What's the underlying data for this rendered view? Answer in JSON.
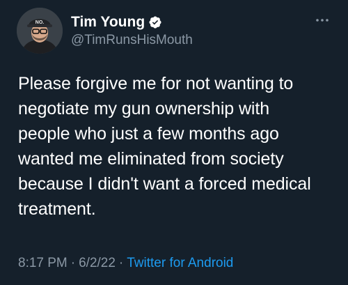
{
  "author": {
    "display_name": "Tim Young",
    "handle": "@TimRunsHisMouth",
    "verified": true,
    "avatar_icon": "user-avatar",
    "hat_text": "NO."
  },
  "tweet": {
    "text": "Please forgive me for not wanting to\nnegotiate my gun ownership with\npeople who just a few months ago\nwanted me eliminated from society\nbecause I didn't want a forced medical\ntreatment.",
    "time": "8:17 PM",
    "date": "6/2/22",
    "separator": "·",
    "source": "Twitter for Android"
  },
  "colors": {
    "background": "#15202b",
    "text": "#ffffff",
    "secondary": "#8b98a5",
    "accent": "#1d9bf0"
  },
  "icons": {
    "more": "more-options-icon",
    "verified": "verified-badge-icon"
  }
}
